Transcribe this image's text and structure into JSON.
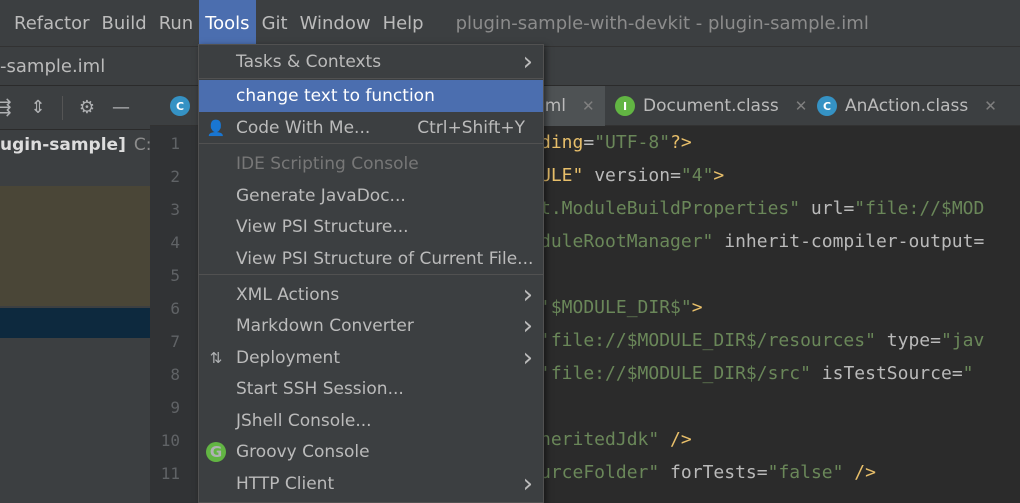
{
  "menubar": {
    "items": [
      "Refactor",
      "Build",
      "Run",
      "Tools",
      "Git",
      "Window",
      "Help"
    ],
    "active": "Tools",
    "title": "plugin-sample-with-devkit - plugin-sample.iml"
  },
  "navbar": {
    "crumb": "-sample.iml"
  },
  "project": {
    "root_name": "ugin-sample]",
    "root_path": "C:\\Us"
  },
  "editor": {
    "tabs": [
      {
        "label": "iml",
        "icon": ""
      },
      {
        "label": "Document.class",
        "icon": "I"
      },
      {
        "label": "AnAction.class",
        "icon": "C"
      }
    ],
    "first_tab_icon": "C",
    "line_numbers": [
      "1",
      "2",
      "3",
      "4",
      "5",
      "6",
      "7",
      "8",
      "9",
      "10",
      "11"
    ],
    "lines": [
      {
        "parts": [
          [
            "k",
            "ding"
          ],
          [
            "a",
            "="
          ],
          [
            "s",
            "\"UTF-8\""
          ],
          [
            "k",
            "?>"
          ]
        ]
      },
      {
        "parts": [
          [
            "k",
            "ULE\""
          ],
          [
            "a",
            " version"
          ],
          [
            "a",
            "="
          ],
          [
            "s",
            "\"4\""
          ],
          [
            "k",
            ">"
          ]
        ]
      },
      {
        "parts": [
          [
            "s",
            "t.ModuleBuildProperties\""
          ],
          [
            "a",
            " url"
          ],
          [
            "a",
            "="
          ],
          [
            "s",
            "\"file://$MOD"
          ]
        ]
      },
      {
        "parts": [
          [
            "s",
            "duleRootManager\""
          ],
          [
            "a",
            " inherit-compiler-output="
          ]
        ]
      },
      {
        "parts": []
      },
      {
        "parts": [
          [
            "s",
            "'$MODULE_DIR$\""
          ],
          [
            "k",
            ">"
          ]
        ]
      },
      {
        "parts": [
          [
            "s",
            "'file://$MODULE_DIR$/resources\""
          ],
          [
            "a",
            " type"
          ],
          [
            "a",
            "="
          ],
          [
            "s",
            "\"jav"
          ]
        ]
      },
      {
        "parts": [
          [
            "s",
            "'file://$MODULE_DIR$/src\""
          ],
          [
            "a",
            " isTestSource"
          ],
          [
            "a",
            "="
          ],
          [
            "s",
            "\""
          ]
        ]
      },
      {
        "parts": []
      },
      {
        "parts": [
          [
            "s",
            "neritedJdk\""
          ],
          [
            "k",
            " />"
          ]
        ]
      },
      {
        "parts": [
          [
            "s",
            "urceFolder\""
          ],
          [
            "a",
            " forTests"
          ],
          [
            "a",
            "="
          ],
          [
            "s",
            "\"false\""
          ],
          [
            "k",
            " />"
          ]
        ]
      }
    ]
  },
  "tools_menu": {
    "items": [
      {
        "label": "Tasks & Contexts",
        "submenu": true
      },
      {
        "label": "change text to function",
        "selected": true
      },
      {
        "label": "Code With Me...",
        "shortcut": "Ctrl+Shift+Y",
        "icon": "code-with-me-icon"
      },
      {
        "label": "IDE Scripting Console",
        "disabled": true
      },
      {
        "label": "Generate JavaDoc..."
      },
      {
        "label": "View PSI Structure..."
      },
      {
        "label": "View PSI Structure of Current File..."
      },
      {
        "label": "XML Actions",
        "submenu": true
      },
      {
        "label": "Markdown Converter",
        "submenu": true
      },
      {
        "label": "Deployment",
        "submenu": true,
        "icon": "deployment-icon"
      },
      {
        "label": "Start SSH Session..."
      },
      {
        "label": "JShell Console..."
      },
      {
        "label": "Groovy Console",
        "icon": "groovy-icon",
        "icon_letter": "G"
      },
      {
        "label": "HTTP Client",
        "submenu": true
      }
    ]
  }
}
